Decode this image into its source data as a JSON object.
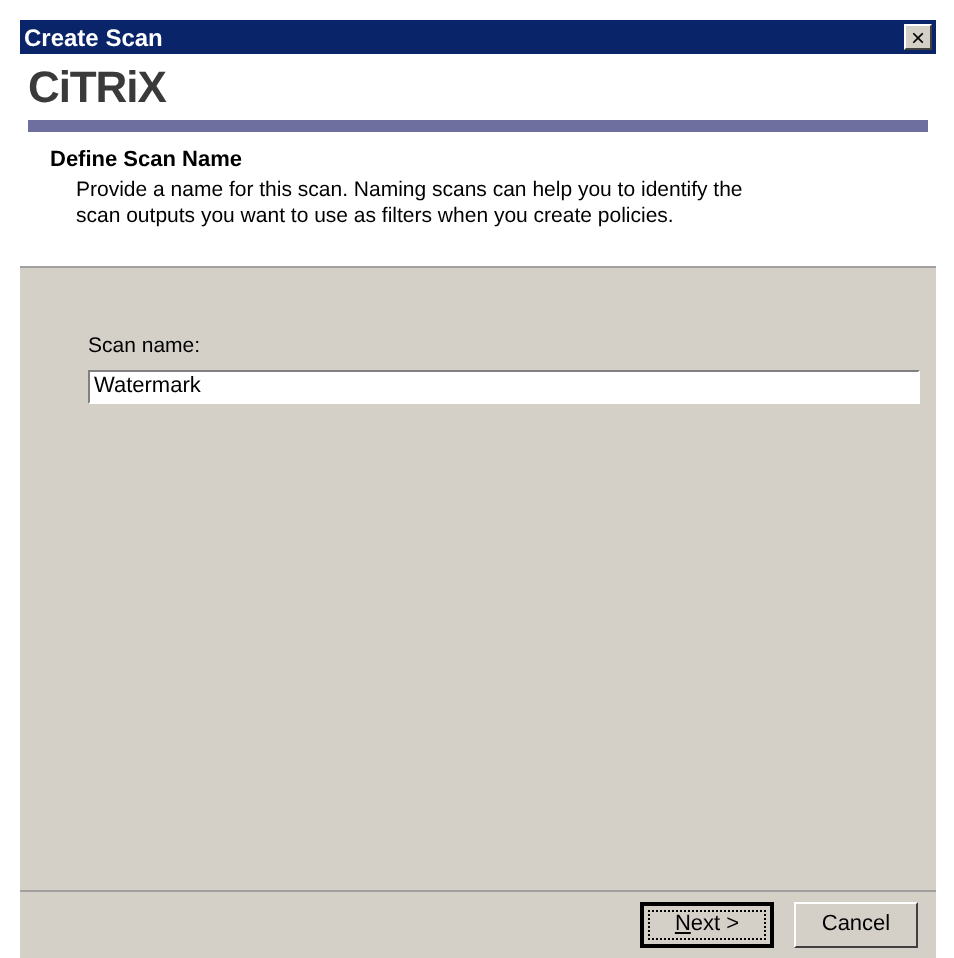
{
  "window": {
    "title": "Create Scan",
    "close": "×"
  },
  "logo": {
    "text": "CiTRiX"
  },
  "header": {
    "title": "Define Scan Name",
    "description": "Provide a name for this scan. Naming scans can help you to identify the scan outputs you want to use as filters when you create policies."
  },
  "form": {
    "label": "Scan name:",
    "value": "Watermark"
  },
  "buttons": [
    {
      "label": "Next >",
      "default": true,
      "mnemonic_underlined": true
    },
    {
      "label": "Cancel",
      "default": false
    }
  ]
}
